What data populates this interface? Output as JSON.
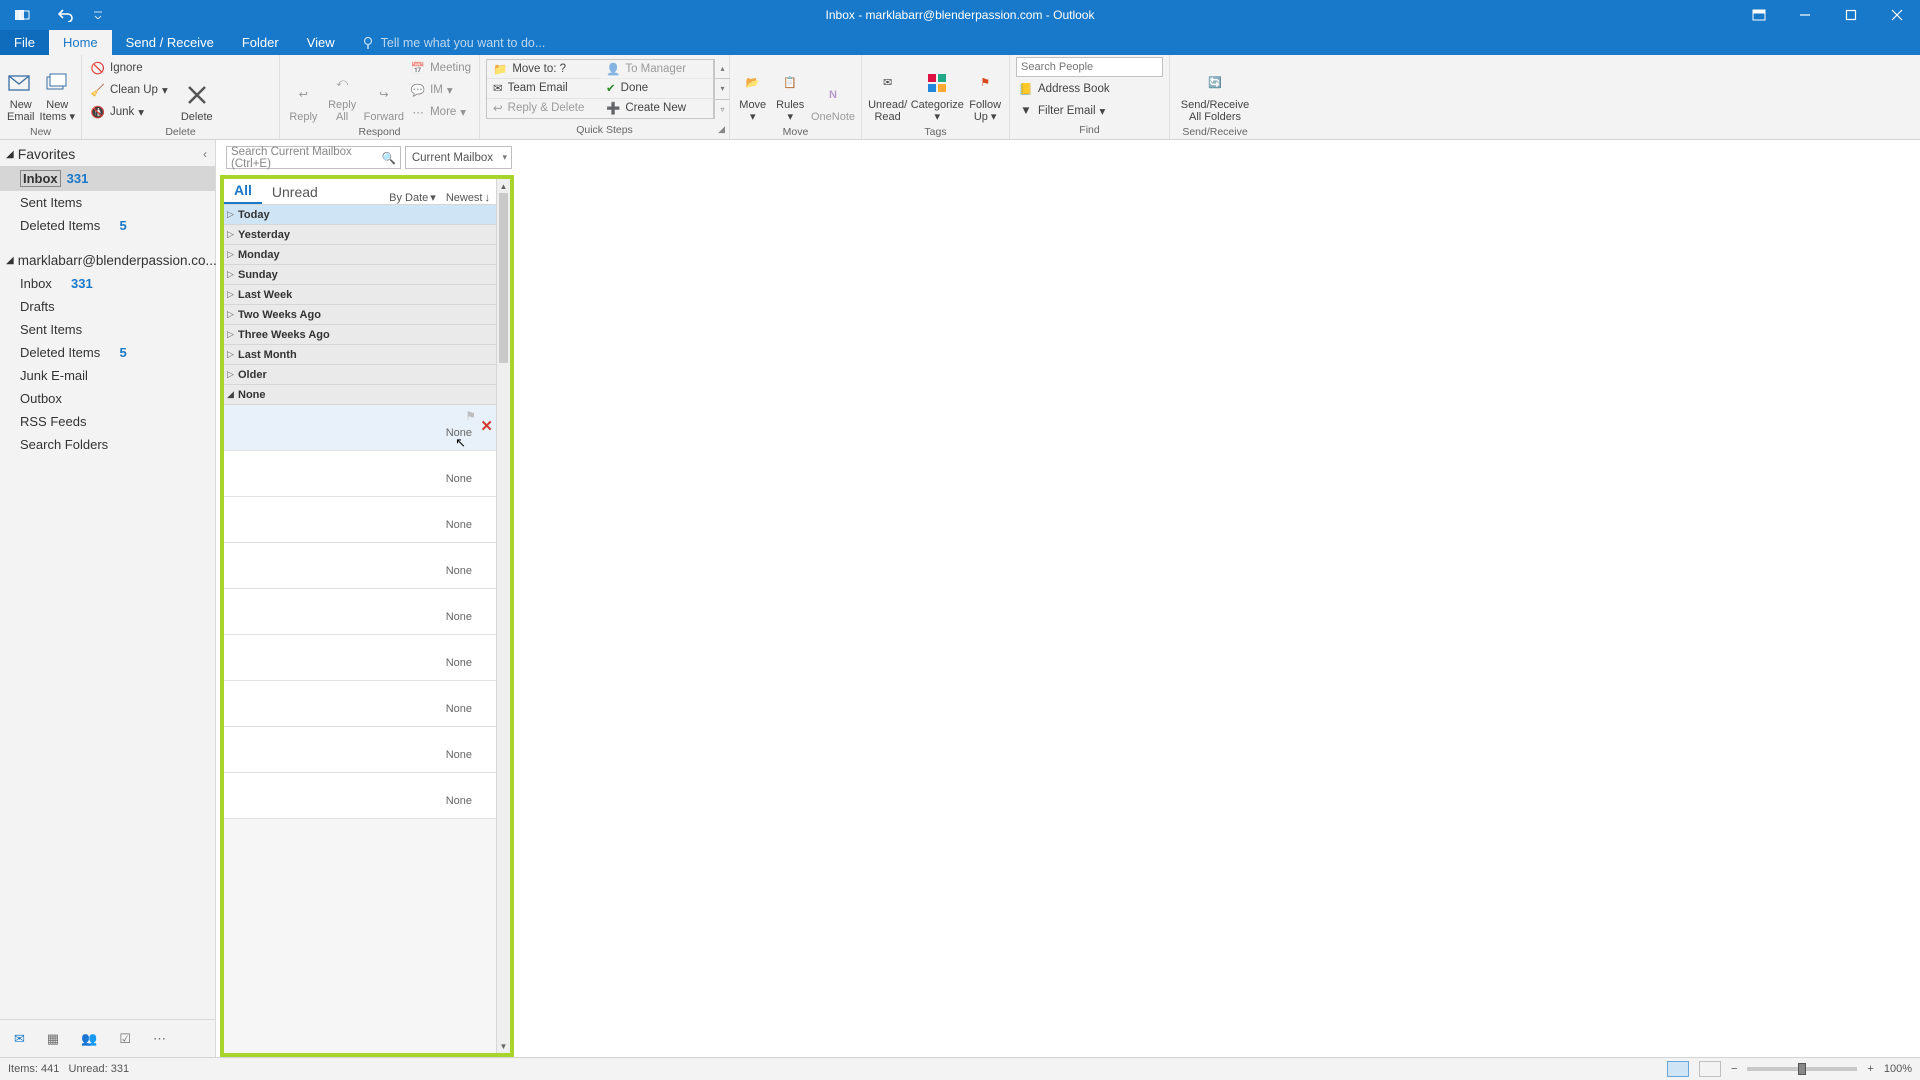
{
  "window": {
    "title": "Inbox - marklabarr@blenderpassion.com - Outlook"
  },
  "tabs": {
    "file": "File",
    "home": "Home",
    "send_receive": "Send / Receive",
    "folder": "Folder",
    "view": "View",
    "tell_me": "Tell me what you want to do..."
  },
  "ribbon": {
    "new": {
      "label": "New",
      "new_email": "New\nEmail",
      "new_items": "New\nItems"
    },
    "delete": {
      "label": "Delete",
      "ignore": "Ignore",
      "clean_up": "Clean Up",
      "junk": "Junk",
      "delete_btn": "Delete"
    },
    "respond": {
      "label": "Respond",
      "reply": "Reply",
      "reply_all": "Reply\nAll",
      "forward": "Forward",
      "meeting": "Meeting",
      "im": "IM",
      "more": "More"
    },
    "quick_steps": {
      "label": "Quick Steps",
      "move_to": "Move to: ?",
      "team_email": "Team Email",
      "reply_delete": "Reply & Delete",
      "to_manager": "To Manager",
      "done": "Done",
      "create_new": "Create New"
    },
    "move": {
      "label": "Move",
      "move_btn": "Move",
      "rules": "Rules",
      "onenote": "OneNote"
    },
    "tags": {
      "label": "Tags",
      "unread": "Unread/\nRead",
      "categorize": "Categorize",
      "follow_up": "Follow\nUp"
    },
    "find": {
      "label": "Find",
      "search_people": "Search People",
      "address_book": "Address Book",
      "filter_email": "Filter Email"
    },
    "send_receive": {
      "label": "Send/Receive",
      "btn": "Send/Receive\nAll Folders"
    }
  },
  "nav": {
    "favorites": "Favorites",
    "account": "marklabarr@blenderpassion.co...",
    "items": {
      "inbox": "Inbox",
      "inbox_count": "331",
      "sent": "Sent Items",
      "deleted": "Deleted Items",
      "deleted_count": "5",
      "drafts": "Drafts",
      "junk": "Junk E-mail",
      "outbox": "Outbox",
      "rss": "RSS Feeds",
      "search_folders": "Search Folders"
    }
  },
  "search": {
    "placeholder": "Search Current Mailbox (Ctrl+E)",
    "scope": "Current Mailbox"
  },
  "list": {
    "tab_all": "All",
    "tab_unread": "Unread",
    "sort_by": "By Date",
    "sort_dir": "Newest",
    "groups": [
      "Today",
      "Yesterday",
      "Monday",
      "Sunday",
      "Last Week",
      "Two Weeks Ago",
      "Three Weeks Ago",
      "Last Month",
      "Older",
      "None"
    ],
    "none_label": "None"
  },
  "status": {
    "items": "Items: 441",
    "unread": "Unread: 331",
    "zoom": "100%"
  }
}
